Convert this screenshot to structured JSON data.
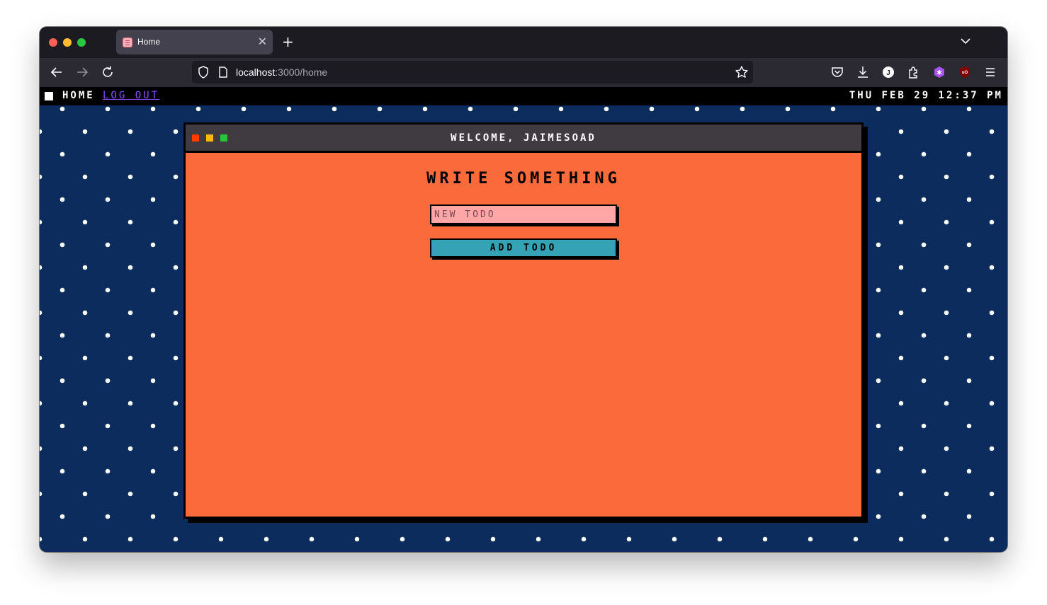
{
  "browser": {
    "tab": {
      "title": "Home",
      "favicon": "page-favicon-icon",
      "close_icon": "close-icon"
    },
    "new_tab_icon": "plus-icon",
    "tab_list_icon": "chevron-down-icon",
    "nav": {
      "back_icon": "arrow-left-icon",
      "forward_icon": "arrow-right-icon",
      "reload_icon": "reload-icon"
    },
    "url": {
      "host": "localhost",
      "rest": ":3000/home"
    },
    "toolbar_icons": [
      "pocket-icon",
      "download-icon",
      "account-icon",
      "extensions-icon",
      "extension-purple-icon",
      "ublock-icon",
      "menu-icon"
    ]
  },
  "app": {
    "menubar": {
      "home_label": "HOME",
      "logout_label": "LOG OUT",
      "clock": "THU FEB 29 12:37 PM"
    },
    "window": {
      "title": "WELCOME, JAIMESOAD",
      "heading": "WRITE SOMETHING",
      "input_placeholder": "NEW TODO",
      "input_value": "",
      "add_button_label": "ADD TODO"
    }
  },
  "colors": {
    "page_background": "#0b2c5c",
    "window_background": "#fb6a3a",
    "input_background": "#ffa6a6",
    "button_background": "#36a2b5",
    "logout_link": "#8a4dff"
  }
}
